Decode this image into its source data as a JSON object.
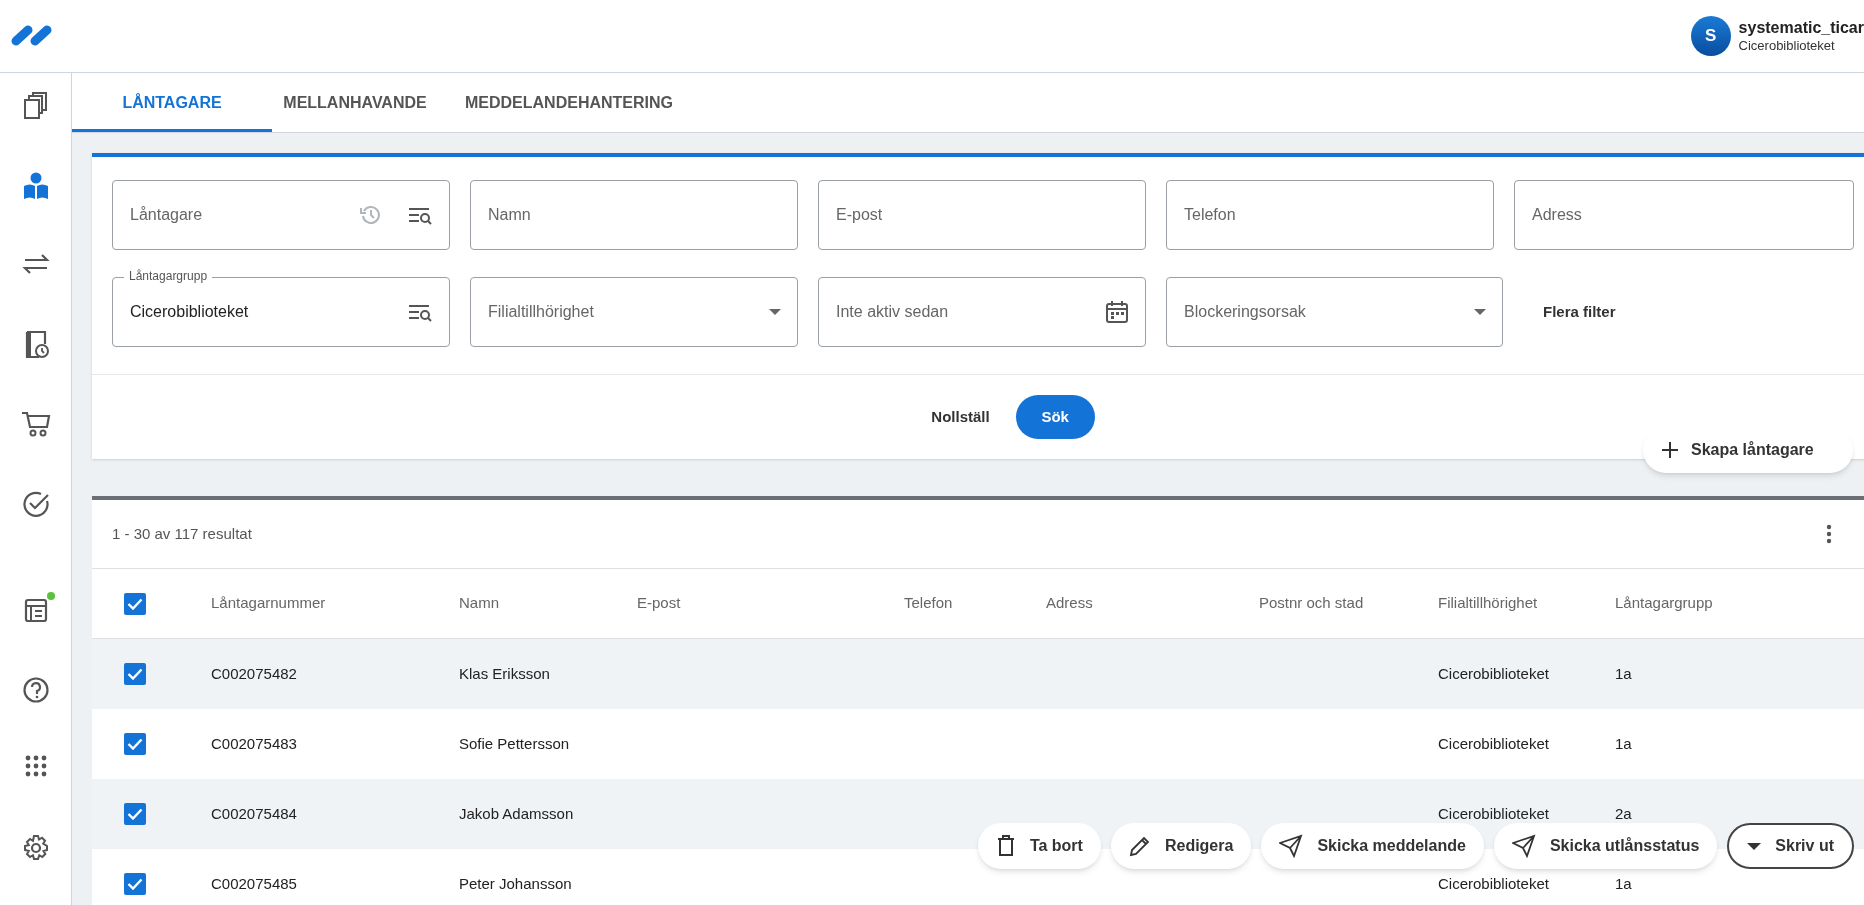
{
  "user": {
    "initial": "S",
    "name": "systematic_ticar",
    "library": "Cicerobiblioteket"
  },
  "sidebar": {
    "items": [
      {
        "selected": false,
        "notification": false
      },
      {
        "selected": true,
        "notification": false
      },
      {
        "selected": false,
        "notification": false
      },
      {
        "selected": false,
        "notification": false
      },
      {
        "selected": false,
        "notification": false
      },
      {
        "selected": false,
        "notification": false
      },
      {
        "selected": false,
        "notification": true
      },
      {
        "selected": false,
        "notification": false
      },
      {
        "selected": false,
        "notification": false
      },
      {
        "selected": false,
        "notification": false
      }
    ]
  },
  "tabs": [
    {
      "label": "LÅNTAGARE",
      "selected": true
    },
    {
      "label": "MELLANHAVANDE",
      "selected": false
    },
    {
      "label": "MEDDELANDEHANTERING",
      "selected": false
    }
  ],
  "filters": {
    "rows": [
      [
        {
          "kind": "search",
          "placeholder": "Låntagare"
        },
        {
          "kind": "text",
          "placeholder": "Namn"
        },
        {
          "kind": "text",
          "placeholder": "E-post"
        },
        {
          "kind": "text",
          "placeholder": "Telefon"
        },
        {
          "kind": "text",
          "placeholder": "Adress"
        }
      ],
      [
        {
          "kind": "lookup",
          "label": "Låntagargrupp",
          "value": "Cicerobiblioteket"
        },
        {
          "kind": "select",
          "placeholder": "Filialtillhörighet"
        },
        {
          "kind": "date",
          "placeholder": "Inte aktiv sedan"
        },
        {
          "kind": "select",
          "placeholder": "Blockeringsorsak"
        }
      ]
    ],
    "more_filters": "Flera filter",
    "reset": "Nollställ",
    "search": "Sök"
  },
  "create_button": "Skapa låntagare",
  "results": {
    "summary": "1 - 30 av 117 resultat",
    "all_selected": true,
    "columns": [
      "Låntagarnummer",
      "Namn",
      "E-post",
      "Telefon",
      "Adress",
      "Postnr och stad",
      "Filialtillhörighet",
      "Låntagargrupp"
    ],
    "rows": [
      {
        "selected": true,
        "cells": [
          "C002075482",
          "Klas Eriksson",
          "",
          "",
          "",
          "",
          "Cicerobiblioteket",
          "1a"
        ]
      },
      {
        "selected": true,
        "cells": [
          "C002075483",
          "Sofie Pettersson",
          "",
          "",
          "",
          "",
          "Cicerobiblioteket",
          "1a"
        ]
      },
      {
        "selected": true,
        "cells": [
          "C002075484",
          "Jakob Adamsson",
          "",
          "",
          "",
          "",
          "Cicerobiblioteket",
          "2a"
        ]
      },
      {
        "selected": true,
        "cells": [
          "C002075485",
          "Peter Johansson",
          "",
          "",
          "",
          "",
          "Cicerobiblioteket",
          "1a"
        ]
      }
    ]
  },
  "actions": [
    {
      "kind": "delete",
      "label": "Ta bort"
    },
    {
      "kind": "edit",
      "label": "Redigera"
    },
    {
      "kind": "send",
      "label": "Skicka meddelande"
    },
    {
      "kind": "send",
      "label": "Skicka utlånsstatus"
    },
    {
      "kind": "menu",
      "label": "Skriv ut"
    }
  ]
}
